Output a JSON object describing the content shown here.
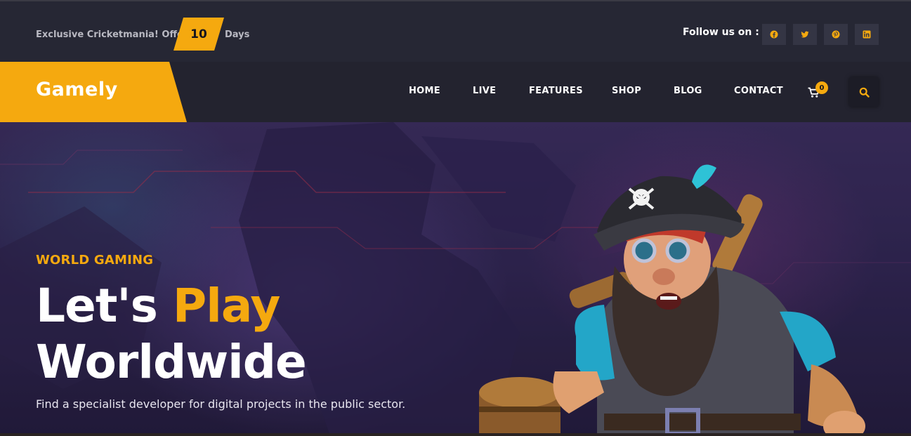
{
  "topbar": {
    "offer_text": "Exclusive Cricketmania! Offer",
    "offer_number": "10",
    "offer_days": "Days",
    "follow_label": "Follow us on :",
    "socials": [
      "facebook-icon",
      "twitter-icon",
      "pinterest-icon",
      "linkedin-icon"
    ]
  },
  "nav": {
    "logo": "Gamely",
    "items": [
      "HOME",
      "LIVE",
      "FEATURES",
      "SHOP",
      "BLOG",
      "CONTACT"
    ],
    "cart_count": "0",
    "cart_icon": "cart-icon",
    "search_icon": "search-icon"
  },
  "hero": {
    "kicker": "WORLD GAMING",
    "title_part1": "Let's ",
    "title_accent": "Play",
    "title_line2": "Worldwide",
    "description": "Find a specialist developer for digital projects in the public sector."
  },
  "colors": {
    "accent": "#f5a90f",
    "topbar_bg": "#262734",
    "navbar_bg": "#23232f"
  }
}
